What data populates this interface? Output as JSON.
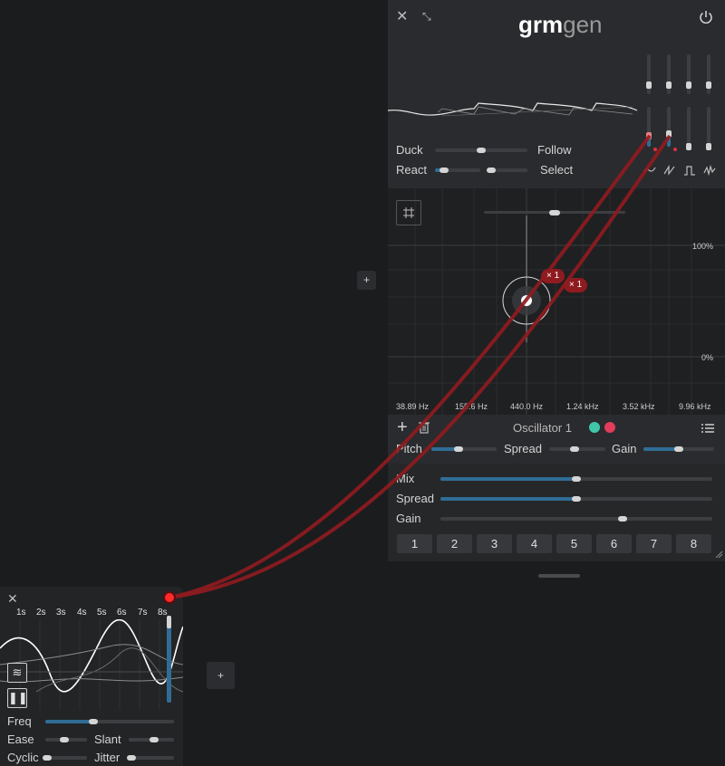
{
  "gen": {
    "logo_bold": "grm",
    "logo_light": "gen",
    "duck_label": "Duck",
    "follow_label": "Follow",
    "react_label": "React",
    "select_label": "Select",
    "duck_value": 0.5,
    "react_value": 0.2,
    "select_value": 0.05,
    "percent_top": "100%",
    "percent_bottom": "0%",
    "freq_labels": [
      "38.89 Hz",
      "155.6 Hz",
      "440.0 Hz",
      "1.24 kHz",
      "3.52 kHz",
      "9.96 kHz"
    ],
    "badge_1": "× 1",
    "badge_2": "× 1",
    "icons": {
      "close": "close-icon",
      "expand": "expand-icon",
      "power": "power-icon",
      "grid": "grid-icon",
      "add": "plus-icon",
      "delete": "trash-icon",
      "list": "list-icon"
    },
    "wave_shapes": [
      "sine-wave-icon",
      "saw-wave-icon",
      "square-wave-icon",
      "noise-wave-icon"
    ]
  },
  "oscillator": {
    "title": "Oscillator 1",
    "color_a": "#3fc7a8",
    "color_b": "#e23d5a",
    "pitch_label": "Pitch",
    "spread_label": "Spread",
    "gain_label": "Gain",
    "pitch_value": 0.42,
    "spread_value": 0.45,
    "gain_value": 0.5
  },
  "mix": {
    "mix_label": "Mix",
    "spread_label": "Spread",
    "gain_label": "Gain",
    "mix_value": 0.5,
    "spread_value": 0.5,
    "gain_value": 0.67,
    "slots": [
      "1",
      "2",
      "3",
      "4",
      "5",
      "6",
      "7",
      "8"
    ]
  },
  "lfo": {
    "ticks": [
      "1s",
      "2s",
      "3s",
      "4s",
      "5s",
      "6s",
      "7s",
      "8s"
    ],
    "freq_label": "Freq",
    "ease_label": "Ease",
    "slant_label": "Slant",
    "cyclic_label": "Cyclic",
    "jitter_label": "Jitter",
    "freq_value": 0.37,
    "ease_value": 0.45,
    "slant_value": 0.55,
    "cyclic_value": 0.05,
    "jitter_value": 0.05,
    "add_label": "+"
  },
  "canvas": {
    "add_label": "+"
  },
  "colors": {
    "accent": "#2f6d96",
    "cable": "#8e1b1f",
    "cable_node": "#ff2a2a"
  }
}
